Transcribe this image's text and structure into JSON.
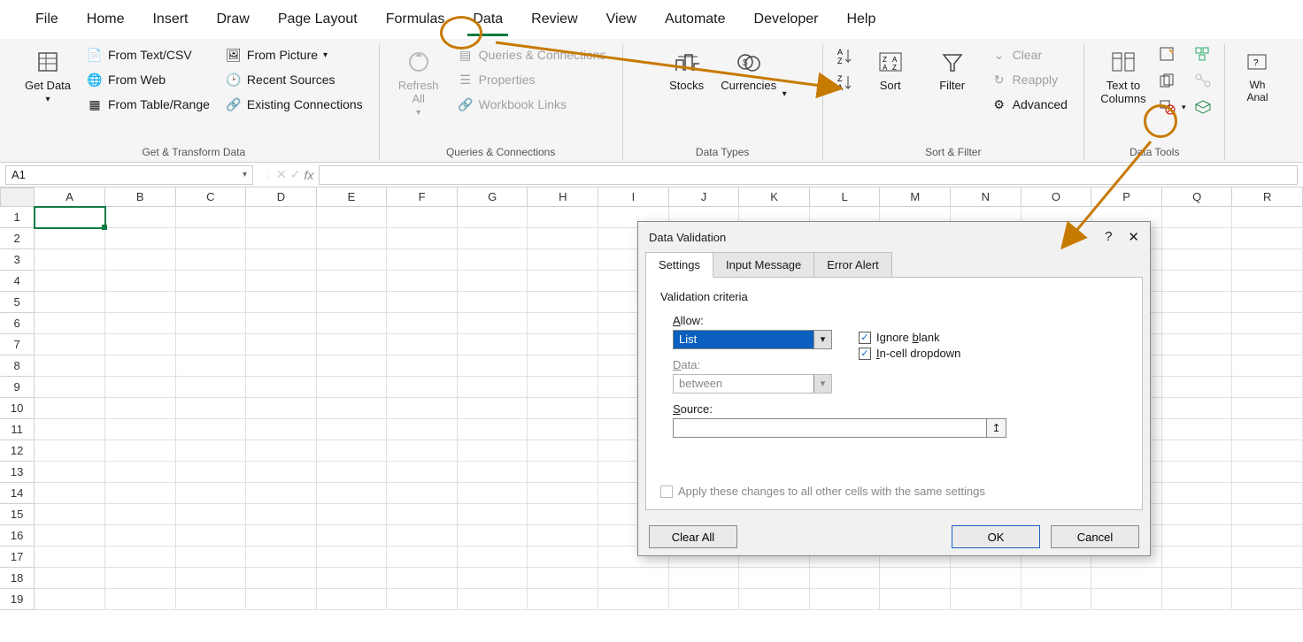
{
  "menu": {
    "items": [
      "File",
      "Home",
      "Insert",
      "Draw",
      "Page Layout",
      "Formulas",
      "Data",
      "Review",
      "View",
      "Automate",
      "Developer",
      "Help"
    ],
    "active": "Data"
  },
  "ribbon": {
    "g1": {
      "label": "Get & Transform Data",
      "getdata": "Get Data",
      "fromtext": "From Text/CSV",
      "fromweb": "From Web",
      "fromtable": "From Table/Range",
      "frompic": "From Picture",
      "recent": "Recent Sources",
      "existing": "Existing Connections"
    },
    "g2": {
      "label": "Queries & Connections",
      "refresh": "Refresh All",
      "qc": "Queries & Connections",
      "props": "Properties",
      "wbl": "Workbook Links"
    },
    "g3": {
      "label": "Data Types",
      "stocks": "Stocks",
      "curr": "Currencies"
    },
    "g4": {
      "label": "Sort & Filter",
      "sort": "Sort",
      "filter": "Filter",
      "clear": "Clear",
      "reapply": "Reapply",
      "adv": "Advanced"
    },
    "g5": {
      "label": "Data Tools",
      "ttc": "Text to Columns"
    },
    "g6": {
      "analyze": "What-If Analysis"
    }
  },
  "namebox": "A1",
  "cols": [
    "A",
    "B",
    "C",
    "D",
    "E",
    "F",
    "G",
    "H",
    "I",
    "J",
    "K",
    "L",
    "M",
    "N",
    "O",
    "P",
    "Q",
    "R"
  ],
  "rows": [
    1,
    2,
    3,
    4,
    5,
    6,
    7,
    8,
    9,
    10,
    11,
    12,
    13,
    14,
    15,
    16,
    17,
    18,
    19
  ],
  "dialog": {
    "title": "Data Validation",
    "tabs": [
      "Settings",
      "Input Message",
      "Error Alert"
    ],
    "vcLabel": "Validation criteria",
    "allowLabel": "Allow:",
    "allowValue": "List",
    "dataLabel": "Data:",
    "dataValue": "between",
    "ignoreBlank": "Ignore blank",
    "incell": "In-cell dropdown",
    "sourceLabel": "Source:",
    "apply": "Apply these changes to all other cells with the same settings",
    "clear": "Clear All",
    "ok": "OK",
    "cancel": "Cancel"
  }
}
